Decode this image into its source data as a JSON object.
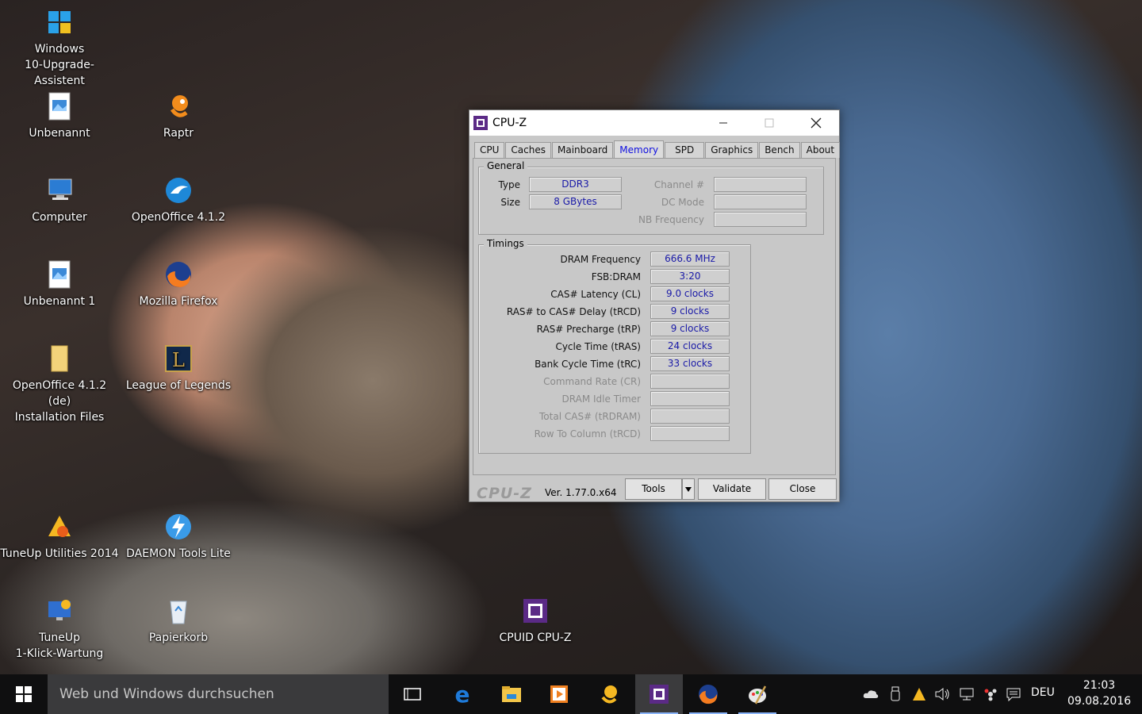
{
  "desktop": {
    "icons": [
      {
        "label": "Windows\n10-Upgrade-Assistent",
        "icon": "windows-upgrade-icon"
      },
      {
        "label": "Unbenannt",
        "icon": "image-file-icon"
      },
      {
        "label": "Raptr",
        "icon": "raptr-icon"
      },
      {
        "label": "Computer",
        "icon": "computer-icon"
      },
      {
        "label": "OpenOffice 4.1.2",
        "icon": "openoffice-icon"
      },
      {
        "label": "Unbenannt 1",
        "icon": "image-file-icon"
      },
      {
        "label": "Mozilla Firefox",
        "icon": "firefox-icon"
      },
      {
        "label": "OpenOffice 4.1.2 (de)\nInstallation Files",
        "icon": "folder-icon"
      },
      {
        "label": "League of Legends",
        "icon": "league-of-legends-icon"
      },
      {
        "label": "TuneUp Utilities 2014",
        "icon": "tuneup-utilities-icon"
      },
      {
        "label": "DAEMON Tools Lite",
        "icon": "daemon-tools-icon"
      },
      {
        "label": "TuneUp\n1-Klick-Wartung",
        "icon": "tuneup-wartung-icon"
      },
      {
        "label": "Papierkorb",
        "icon": "recycle-bin-icon"
      },
      {
        "label": "CPUID CPU-Z",
        "icon": "cpuz-icon"
      }
    ]
  },
  "cpuz": {
    "title": "CPU-Z",
    "tabs": [
      "CPU",
      "Caches",
      "Mainboard",
      "Memory",
      "SPD",
      "Graphics",
      "Bench",
      "About"
    ],
    "active_tab": "Memory",
    "general": {
      "legend": "General",
      "type_label": "Type",
      "type_value": "DDR3",
      "size_label": "Size",
      "size_value": "8 GBytes",
      "channel_label": "Channel #",
      "channel_value": "",
      "dc_mode_label": "DC Mode",
      "dc_mode_value": "",
      "nb_freq_label": "NB Frequency",
      "nb_freq_value": ""
    },
    "timings": {
      "legend": "Timings",
      "rows": [
        {
          "label": "DRAM Frequency",
          "value": "666.6 MHz",
          "enabled": true
        },
        {
          "label": "FSB:DRAM",
          "value": "3:20",
          "enabled": true
        },
        {
          "label": "CAS# Latency (CL)",
          "value": "9.0 clocks",
          "enabled": true
        },
        {
          "label": "RAS# to CAS# Delay (tRCD)",
          "value": "9 clocks",
          "enabled": true
        },
        {
          "label": "RAS# Precharge (tRP)",
          "value": "9 clocks",
          "enabled": true
        },
        {
          "label": "Cycle Time (tRAS)",
          "value": "24 clocks",
          "enabled": true
        },
        {
          "label": "Bank Cycle Time (tRC)",
          "value": "33 clocks",
          "enabled": true
        },
        {
          "label": "Command Rate (CR)",
          "value": "",
          "enabled": false
        },
        {
          "label": "DRAM Idle Timer",
          "value": "",
          "enabled": false
        },
        {
          "label": "Total CAS# (tRDRAM)",
          "value": "",
          "enabled": false
        },
        {
          "label": "Row To Column (tRCD)",
          "value": "",
          "enabled": false
        }
      ]
    },
    "footer": {
      "brand": "CPU-Z",
      "version": "Ver. 1.77.0.x64",
      "tools_label": "Tools",
      "validate_label": "Validate",
      "close_label": "Close"
    }
  },
  "taskbar": {
    "search_placeholder": "Web und Windows durchsuchen",
    "apps": [
      "task-view-icon",
      "edge-icon",
      "file-explorer-icon",
      "media-player-icon",
      "raptr-icon",
      "cpuz-icon",
      "firefox-icon",
      "paint-icon"
    ],
    "language": "DEU",
    "time": "21:03",
    "date": "09.08.2016"
  }
}
